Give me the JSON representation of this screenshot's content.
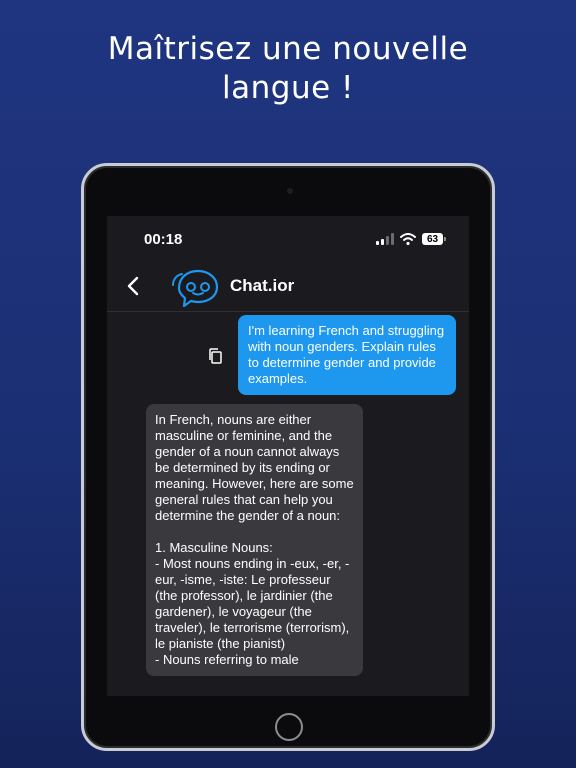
{
  "headline": {
    "line1": "Maîtrisez une nouvelle",
    "line2": "langue !"
  },
  "status_bar": {
    "time": "00:18",
    "battery_level": "63",
    "icons": [
      "cellular-signal-icon",
      "wifi-icon",
      "battery-icon"
    ]
  },
  "nav": {
    "back_icon": "chevron-left-icon",
    "logo_icon": "chat-bubble-logo-icon",
    "title": "Chat.ior"
  },
  "messages": {
    "user": "I'm learning French and struggling with noun genders. Explain rules to determine gender and provide examples.",
    "assistant": "In French, nouns are either masculine or feminine, and the gender of a noun cannot always be determined by its ending or meaning. However, here are some general rules that can help you determine the gender of a noun:\n\n1. Masculine Nouns:\n- Most nouns ending in -eux, -er, -eur, -isme, -iste: Le professeur (the professor), le jardinier (the gardener), le voyageur (the traveler), le terrorisme (terrorism), le pianiste (the pianist)\n- Nouns referring to male",
    "copy_icon": "copy-icon"
  },
  "colors": {
    "background_top": "#1f3580",
    "background_bottom": "#142359",
    "user_bubble": "#1e98ee",
    "assistant_bubble": "#3a3a3e",
    "screen": "#1b1b1f",
    "logo": "#1e98ee"
  }
}
